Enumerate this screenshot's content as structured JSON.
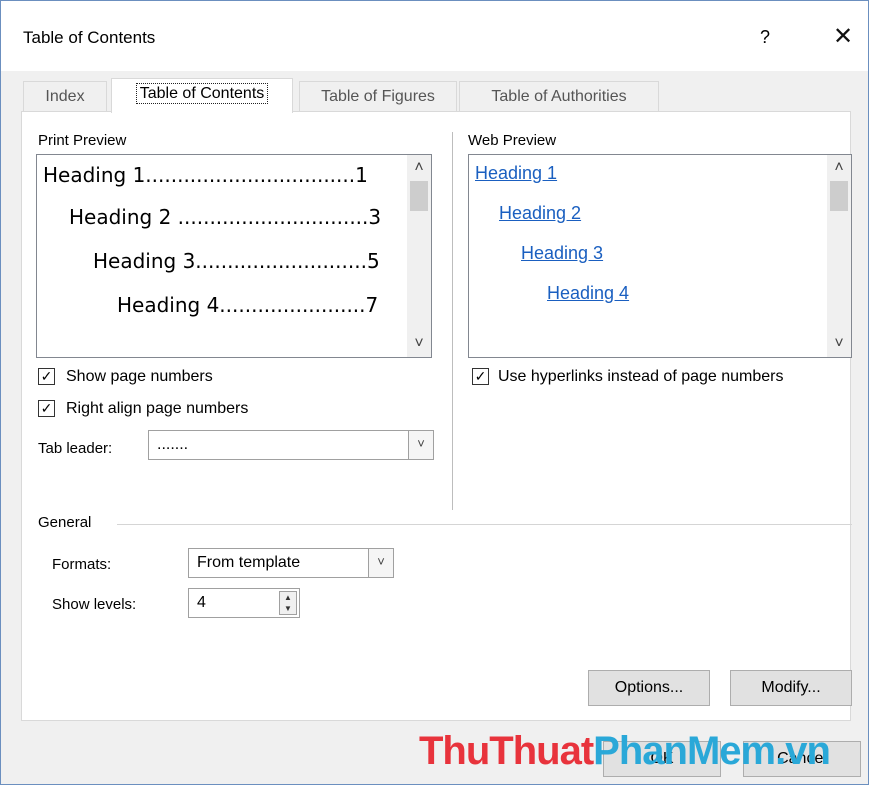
{
  "dialog": {
    "title": "Table of Contents",
    "help": "?",
    "close": "✕"
  },
  "tabs": [
    {
      "label": "Index"
    },
    {
      "label": "Table of Contents"
    },
    {
      "label": "Table of Figures"
    },
    {
      "label": "Table of Authorities"
    }
  ],
  "print_preview": {
    "label": "Print Preview",
    "lines": [
      "Heading 1.................................1",
      "Heading 2 ..............................3",
      "Heading 3...........................5",
      "Heading 4.......................7"
    ]
  },
  "web_preview": {
    "label": "Web Preview",
    "links": [
      "Heading 1",
      "Heading 2",
      "Heading 3",
      "Heading 4"
    ]
  },
  "options": {
    "show_page_numbers": {
      "label": "Show page numbers",
      "checked": true
    },
    "right_align": {
      "label": "Right align page numbers",
      "checked": true
    },
    "use_hyperlinks": {
      "label": "Use hyperlinks instead of page numbers",
      "checked": true
    },
    "tab_leader": {
      "label": "Tab leader:",
      "value": "......."
    }
  },
  "general": {
    "label": "General",
    "formats": {
      "label": "Formats:",
      "value": "From template"
    },
    "show_levels": {
      "label": "Show levels:",
      "value": "4"
    }
  },
  "buttons": {
    "options": "Options...",
    "modify": "Modify...",
    "ok": "OK",
    "cancel": "Cancel"
  },
  "watermark": {
    "part1": "ThuThuat",
    "part2": "PhanMem.vn"
  },
  "icons": {
    "checkmark": "✓",
    "scroll_up": "˄",
    "scroll_down": "˅",
    "dropdown": "˅"
  }
}
